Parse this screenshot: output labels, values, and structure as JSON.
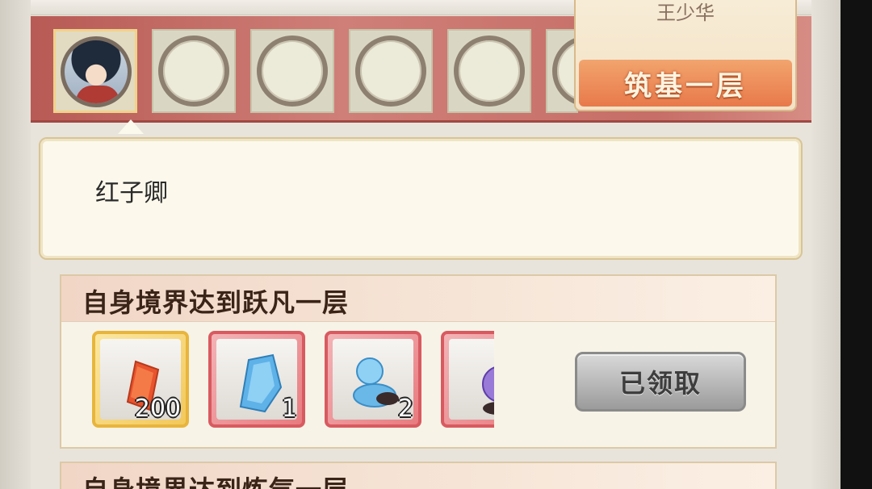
{
  "banner": {
    "realm": {
      "name": "王少华",
      "level": "筑基一层"
    }
  },
  "character": {
    "selected_name": "红子卿"
  },
  "tasks": [
    {
      "title": "自身境界达到跃凡一层",
      "rewards": [
        {
          "icon": "red-gem-icon",
          "rarity": "gold",
          "count": "200"
        },
        {
          "icon": "blue-cloth-icon",
          "rarity": "red",
          "count": "1"
        },
        {
          "icon": "blue-gourd-icon",
          "rarity": "red",
          "count": "2"
        },
        {
          "icon": "purple-pouch-icon",
          "rarity": "red",
          "count": ""
        }
      ],
      "button": "已领取"
    },
    {
      "title": "自身境界达到炼气一层"
    }
  ]
}
